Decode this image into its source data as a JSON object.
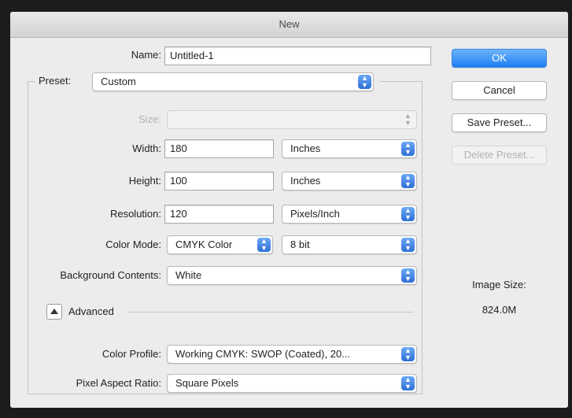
{
  "window": {
    "title": "New"
  },
  "name": {
    "label": "Name:",
    "value": "Untitled-1"
  },
  "preset": {
    "label": "Preset:",
    "value": "Custom"
  },
  "size": {
    "label": "Size:",
    "value": ""
  },
  "width": {
    "label": "Width:",
    "value": "180",
    "unit": "Inches"
  },
  "height": {
    "label": "Height:",
    "value": "100",
    "unit": "Inches"
  },
  "resolution": {
    "label": "Resolution:",
    "value": "120",
    "unit": "Pixels/Inch"
  },
  "color_mode": {
    "label": "Color Mode:",
    "value": "CMYK Color",
    "depth": "8 bit"
  },
  "background": {
    "label": "Background Contents:",
    "value": "White"
  },
  "advanced": {
    "label": "Advanced"
  },
  "color_profile": {
    "label": "Color Profile:",
    "value": "Working CMYK:  SWOP (Coated), 20..."
  },
  "pixel_aspect": {
    "label": "Pixel Aspect Ratio:",
    "value": "Square Pixels"
  },
  "buttons": {
    "ok": "OK",
    "cancel": "Cancel",
    "save_preset": "Save Preset...",
    "delete_preset": "Delete Preset..."
  },
  "image_size": {
    "label": "Image Size:",
    "value": "824.0M"
  },
  "colors": {
    "accent": "#1d7ff2"
  },
  "icons": {
    "popup": "up-down-arrows-icon",
    "disclosure": "disclosure-triangle-icon"
  }
}
